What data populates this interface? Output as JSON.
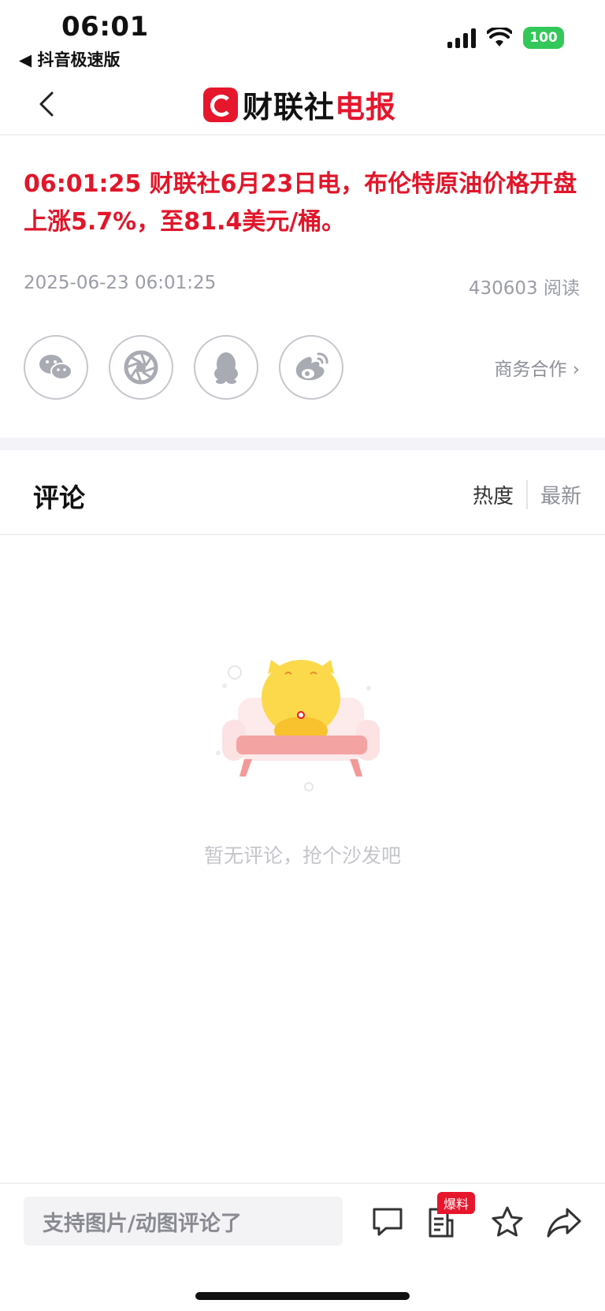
{
  "status_bar": {
    "time": "06:01",
    "back_app": "◀ 抖音极速版",
    "battery": "100"
  },
  "nav": {
    "logo_black": "财联社",
    "logo_red": "电报"
  },
  "article": {
    "headline": "06:01:25  财联社6月23日电，布伦特原油价格开盘上涨5.7%，至81.4美元/桶。",
    "datetime": "2025-06-23 06:01:25",
    "reads": "430603 阅读",
    "business_link": "商务合作 ›"
  },
  "share_icons": [
    "wechat-icon",
    "moments-icon",
    "qq-icon",
    "weibo-icon"
  ],
  "comments": {
    "title": "评论",
    "sort_hot": "热度",
    "sort_new": "最新",
    "empty_text": "暂无评论，抢个沙发吧"
  },
  "bottom_bar": {
    "input_placeholder": "支持图片/动图评论了",
    "tip_badge": "爆料"
  },
  "colors": {
    "accent": "#e1162a",
    "muted": "#9a9ca6"
  }
}
